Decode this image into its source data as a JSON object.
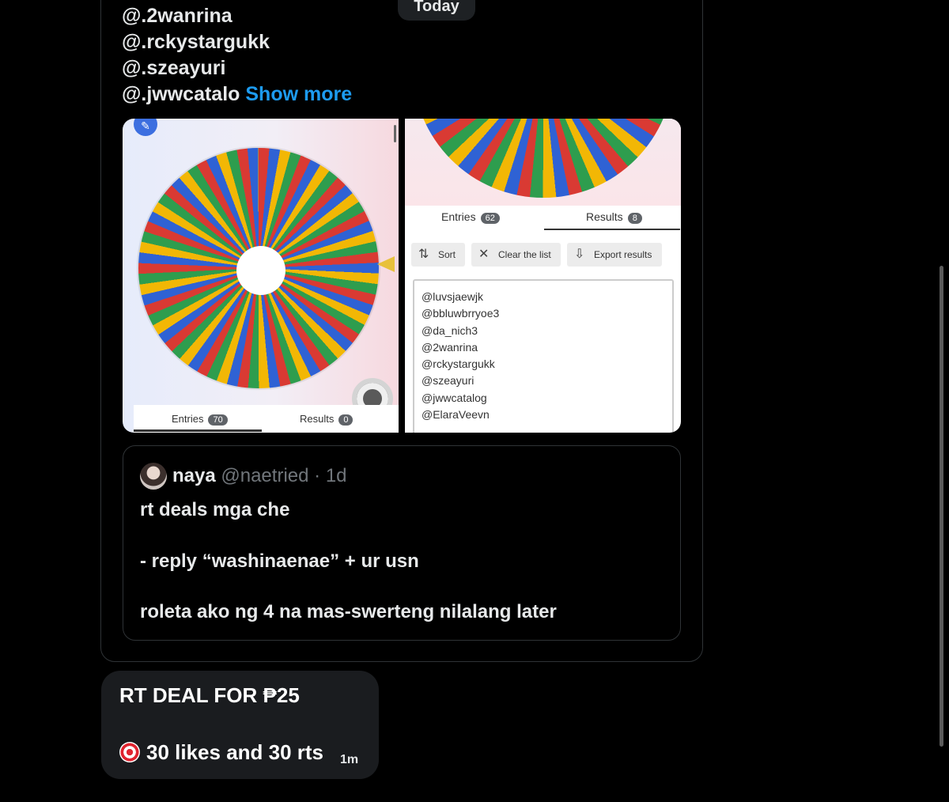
{
  "date_separator": "Today",
  "message": {
    "handles": [
      "@.2wanrina",
      "@.rckystargukk",
      "@.szeayuri",
      "@.jwwcatalo"
    ],
    "show_more": "Show more"
  },
  "left_screenshot": {
    "tabs": [
      {
        "label": "Entries",
        "count": "70"
      },
      {
        "label": "Results",
        "count": "0"
      }
    ]
  },
  "right_screenshot": {
    "tabs": [
      {
        "label": "Entries",
        "count": "62"
      },
      {
        "label": "Results",
        "count": "8"
      }
    ],
    "toolbar": {
      "sort": "Sort",
      "clear": "Clear the list",
      "export": "Export results"
    },
    "results": [
      "@luvsjaewjk",
      "@bbluwbrryoe3",
      "@da_nich3",
      "@2wanrina",
      "@rckystargukk",
      "@szeayuri",
      "@jwwcatalog",
      "@ElaraVeevn"
    ]
  },
  "quoted_post": {
    "name": "naya",
    "handle": "@naetried",
    "separator": "·",
    "age": "1d",
    "lines": [
      "rt deals mga che",
      "- reply “washinaenae” + ur usn",
      "roleta ako ng 4 na mas-swerteng nilalang later"
    ]
  },
  "reply_bubble": {
    "title": "RT DEAL FOR ₱25",
    "line": "30 likes and 30 rts",
    "time": "1m",
    "icon": "dart-target-icon"
  }
}
